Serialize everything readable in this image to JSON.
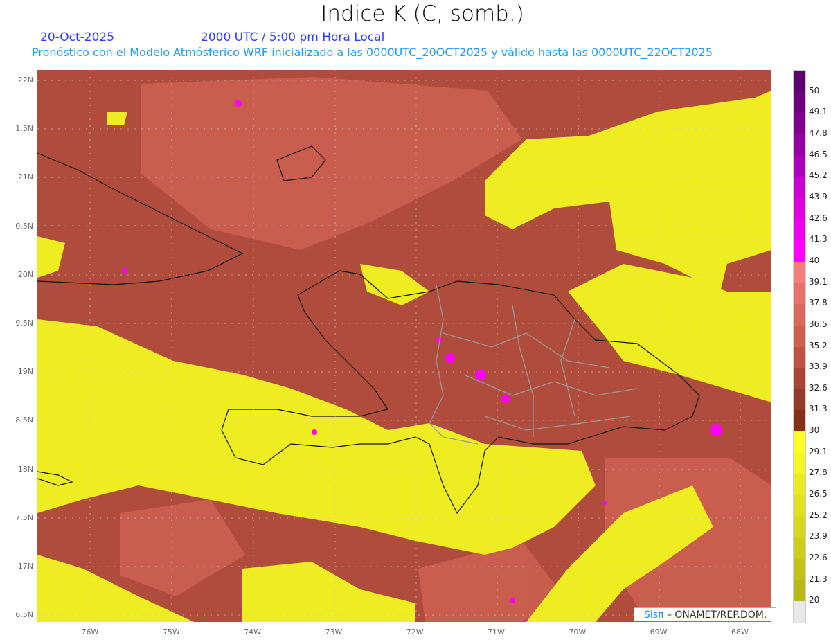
{
  "title": "Indice K (C, somb.)",
  "date": "20-Oct-2025",
  "time": "2000 UTC / 5:00 pm Hora Local",
  "subtitle": "Pronóstico con el Modelo Atmósferico WRF inicializado a las 0000UTC_20OCT2025 y válido hasta las  0000UTC_22OCT2025",
  "lat_labels": [
    "22N",
    "1.5N",
    "21N",
    "0.5N",
    "20N",
    "9.5N",
    "19N",
    "8.5N",
    "18N",
    "7.5N",
    "17N",
    "6.5N"
  ],
  "lon_labels": [
    "76W",
    "75W",
    "74W",
    "73W",
    "72W",
    "71W",
    "70W",
    "69W",
    "68W"
  ],
  "colorbar": {
    "labels": [
      "50",
      "49.1",
      "47.8",
      "46.5",
      "45.2",
      "43.9",
      "42.6",
      "41.3",
      "40",
      "39.1",
      "37.8",
      "36.5",
      "35.2",
      "33.9",
      "32.6",
      "31.3",
      "30",
      "29.1",
      "27.8",
      "26.5",
      "25.2",
      "23.9",
      "22.6",
      "21.3",
      "20"
    ],
    "colors": [
      "#5e0070",
      "#6e0080",
      "#82008f",
      "#9700a6",
      "#ad00bd",
      "#c800d2",
      "#dd00dd",
      "#ef00ee",
      "#ff00ff",
      "#f47f7a",
      "#e8716a",
      "#dc675d",
      "#cf5d50",
      "#bf5244",
      "#aa4535",
      "#963a29",
      "#86301a",
      "#ffff22",
      "#f6f622",
      "#ebea20",
      "#e1e11f",
      "#d7d71d",
      "#cdcd1b",
      "#c2c21a",
      "#b8b818",
      "#e8e8e8"
    ]
  },
  "credit": {
    "brand": "Sisπ",
    "text": " –  ONAMET/REP.DOM."
  }
}
